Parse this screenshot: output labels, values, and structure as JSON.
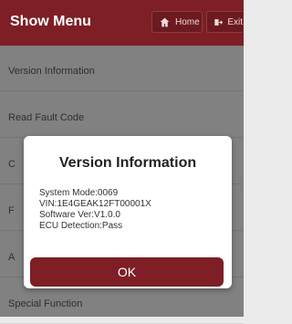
{
  "header": {
    "title": "Show Menu",
    "home_label": "Home",
    "exit_label": "Exit"
  },
  "menu": {
    "items": [
      {
        "label": "Version Information"
      },
      {
        "label": "Read Fault Code"
      },
      {
        "label": "C"
      },
      {
        "label": "F"
      },
      {
        "label": "A"
      },
      {
        "label": "Special Function"
      }
    ]
  },
  "dialog": {
    "title": "Version Information",
    "lines": [
      "System Mode:0069",
      "VIN:1E4GEAK12FT00001X",
      "Software Ver:V1.0.0",
      "ECU Detection:Pass"
    ],
    "ok_label": "OK"
  },
  "colors": {
    "accent": "#7d1f25",
    "background": "#ebebeb"
  }
}
